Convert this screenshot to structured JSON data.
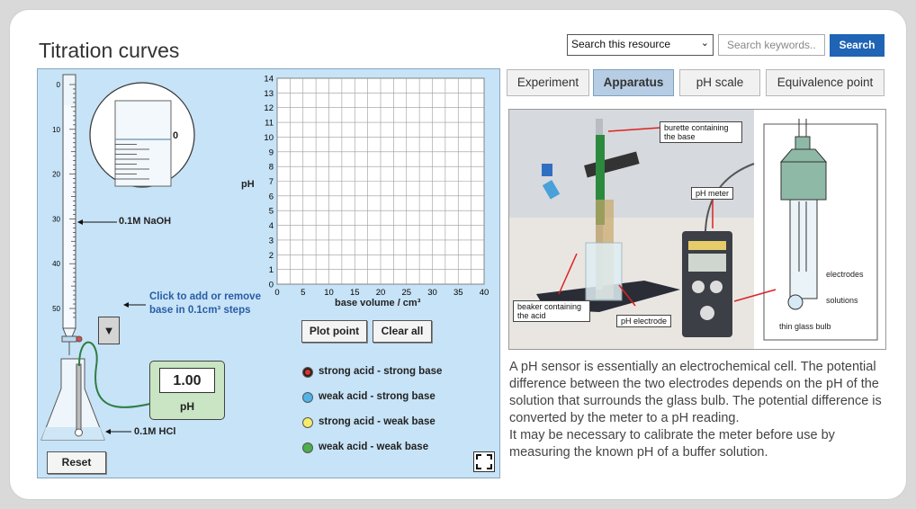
{
  "title": "Titration curves",
  "header": {
    "resource_select": "Search this resource",
    "search_placeholder": "Search keywords..",
    "search_button": "Search"
  },
  "sim": {
    "burette_label": "0.1M NaOH",
    "flask_label": "0.1M HCl",
    "zoom_value": "0",
    "hint_line1": "Click to add or remove",
    "hint_line2": "base in 0.1cm³ steps",
    "ph_value": "1.00",
    "ph_unit": "pH",
    "reset": "Reset",
    "plot_point": "Plot point",
    "clear_all": "Clear all",
    "y_axis_label": "pH",
    "x_axis_label": "base volume / cm³",
    "x_ticks": [
      "0",
      "5",
      "10",
      "15",
      "20",
      "25",
      "30",
      "35",
      "40"
    ],
    "y_ticks": [
      "0",
      "1",
      "2",
      "3",
      "4",
      "5",
      "6",
      "7",
      "8",
      "9",
      "10",
      "11",
      "12",
      "13",
      "14"
    ],
    "burette_ticks": [
      "0",
      "10",
      "20",
      "30",
      "40",
      "50"
    ],
    "legend": [
      {
        "label": "strong acid - strong base",
        "color": "#e0322a",
        "selected": true
      },
      {
        "label": "weak acid - strong base",
        "color": "#4fb3e8",
        "selected": false
      },
      {
        "label": "strong acid - weak base",
        "color": "#f4ec6c",
        "selected": false
      },
      {
        "label": "weak acid - weak base",
        "color": "#4cae4c",
        "selected": false
      }
    ]
  },
  "tabs": [
    {
      "label": "Experiment",
      "active": false
    },
    {
      "label": "Apparatus",
      "active": true
    },
    {
      "label": "pH scale",
      "active": false
    },
    {
      "label": "Equivalence point",
      "active": false
    }
  ],
  "photo": {
    "burette_line1": "burette containing",
    "burette_line2": "the base",
    "meter": "pH meter",
    "beaker_line1": "beaker containing",
    "beaker_line2": "the acid",
    "electrode": "pH electrode",
    "electrodes": "electrodes",
    "solutions": "solutions",
    "bulb": "thin glass bulb"
  },
  "description": [
    "A pH sensor is essentially an electrochemical cell. The potential difference between the two electrodes depends on the pH of the solution that surrounds the glass bulb. The potential difference is converted by the meter to a pH reading.",
    "It may be necessary to calibrate the meter before use by measuring the known pH of a buffer solution."
  ],
  "chart_data": {
    "type": "line",
    "xlabel": "base volume / cm³",
    "ylabel": "pH",
    "xlim": [
      0,
      40
    ],
    "ylim": [
      0,
      14
    ],
    "grid": true,
    "series": []
  }
}
